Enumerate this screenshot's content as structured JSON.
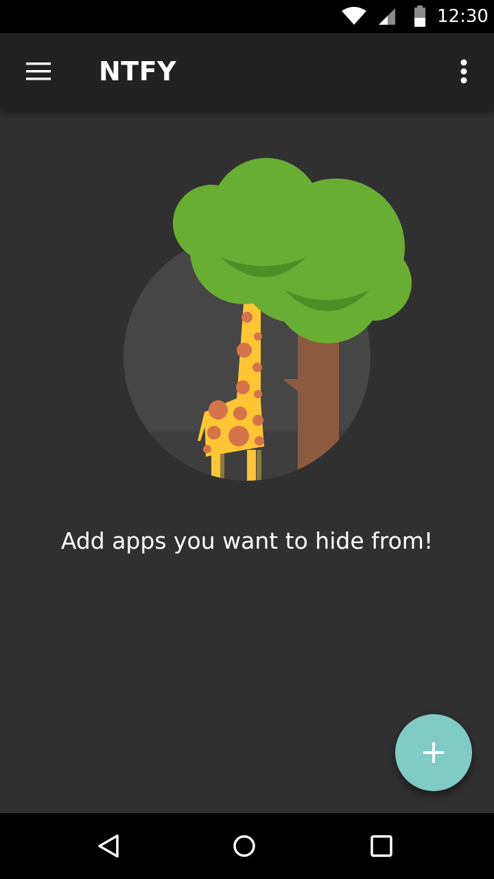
{
  "status_bar": {
    "time": "12:30",
    "icons": [
      "wifi-icon",
      "cell-signal-icon",
      "battery-icon"
    ]
  },
  "app_bar": {
    "title": "NTFY",
    "menu_icon": "hamburger-menu-icon",
    "overflow_icon": "more-vert-icon"
  },
  "content": {
    "empty_message": "Add apps you want to hide from!",
    "illustration": "giraffe-tree-illustration"
  },
  "fab": {
    "icon": "plus-icon",
    "color": "#80cbc4"
  },
  "nav_bar": {
    "icons": [
      "back-icon",
      "home-icon",
      "recents-icon"
    ]
  },
  "colors": {
    "background": "#303030",
    "app_bar": "#212121",
    "accent": "#80cbc4",
    "tree_green": "#6aad33",
    "trunk_brown": "#8b5a3f",
    "giraffe_yellow": "#fdc632",
    "giraffe_spots": "#d5744a"
  }
}
